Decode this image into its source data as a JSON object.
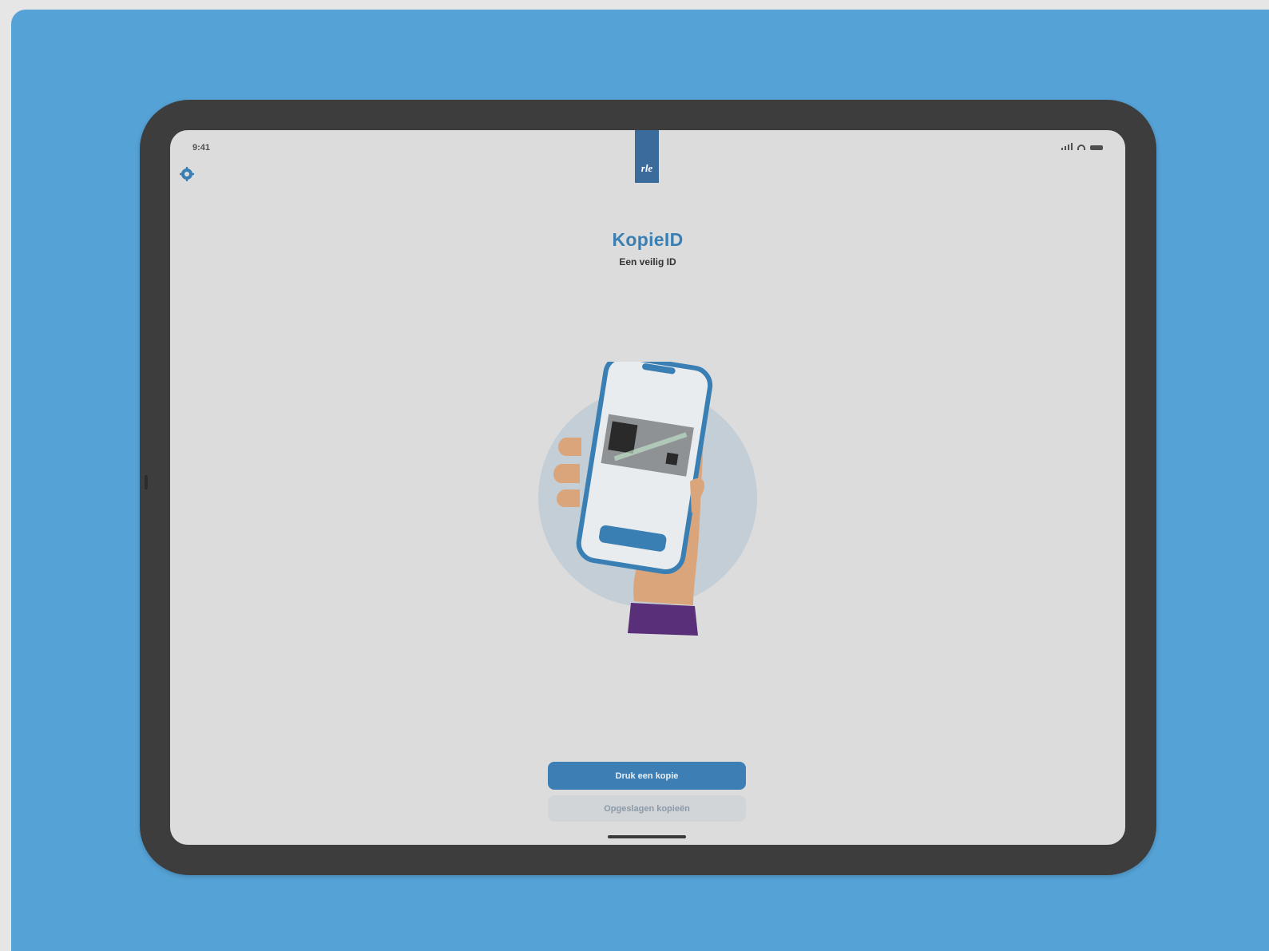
{
  "status_bar": {
    "time": "9:41",
    "icons": [
      "cellular-signal-icon",
      "wifi-icon",
      "battery-icon"
    ]
  },
  "header": {
    "settings_icon": "gear-icon",
    "logo_text": "rle"
  },
  "main": {
    "title": "KopieID",
    "subtitle": "Een veilig ID",
    "illustration": "hand-holding-phone-scanning-id-card"
  },
  "actions": {
    "primary_label": "Druk een kopie",
    "secondary_label": "Opgeslagen kopieën"
  },
  "colors": {
    "background_panel": "#55a2d6",
    "device_frame": "#3d3d3d",
    "screen": "#dcdcdc",
    "accent": "#3a7fb4",
    "primary_button": "#3d7fb5",
    "secondary_button": "#d2d5d8"
  }
}
